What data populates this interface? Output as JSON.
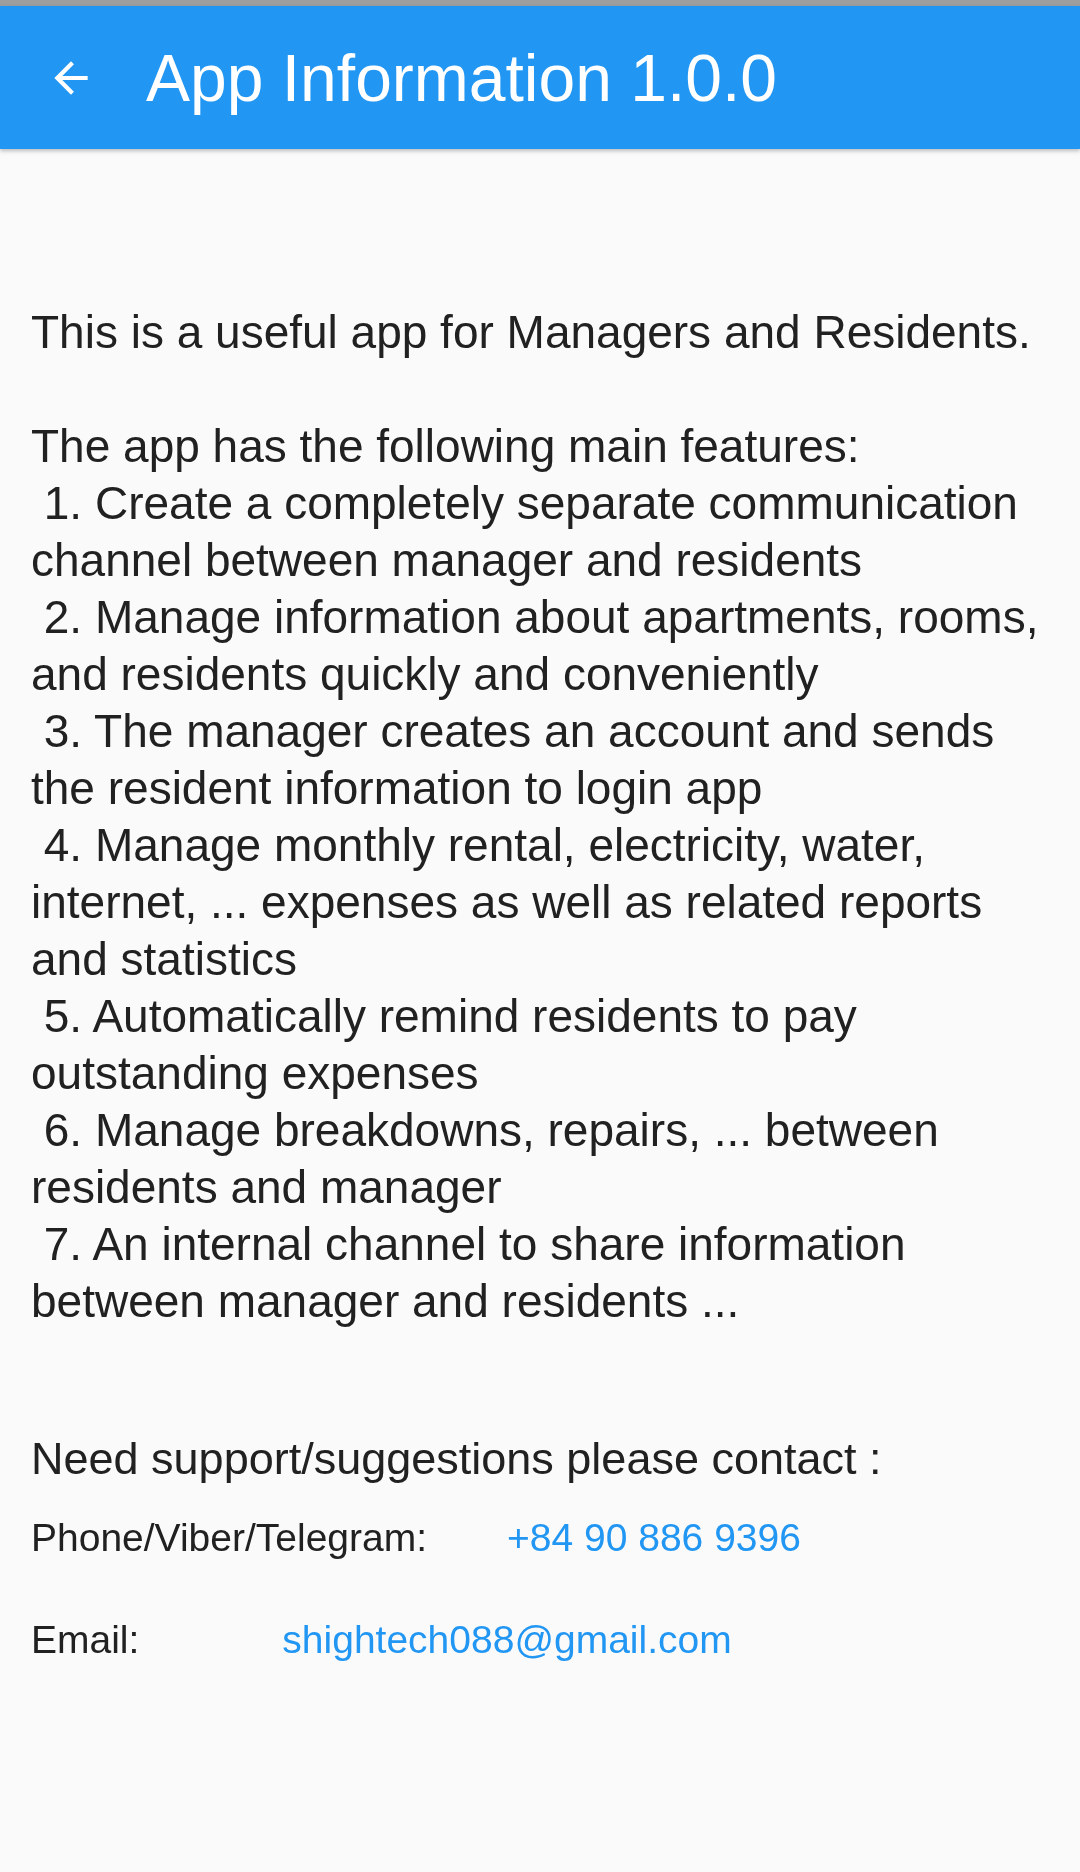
{
  "app_bar": {
    "title": "App Information 1.0.0"
  },
  "description": "This is a useful app for Managers and Residents.\n\nThe app has the following main features:\n 1. Create a completely separate communication channel between manager and residents\n 2. Manage information about apartments, rooms, and residents quickly and conveniently\n 3. The manager creates an account and sends the resident information to login app\n 4. Manage monthly rental, electricity, water, internet, ... expenses as well as related reports and statistics\n 5. Automatically remind residents to pay outstanding expenses\n 6. Manage breakdowns, repairs, ... between residents and manager\n 7. An internal channel to share information between manager and residents ...",
  "support": {
    "heading": "Need support/suggestions please contact :",
    "contacts": [
      {
        "kind": "phone",
        "label": "Phone/Viber/Telegram:",
        "value": "+84 90 886 9396"
      },
      {
        "kind": "email",
        "label": "Email:",
        "value": "shightech088@gmail.com"
      }
    ]
  }
}
